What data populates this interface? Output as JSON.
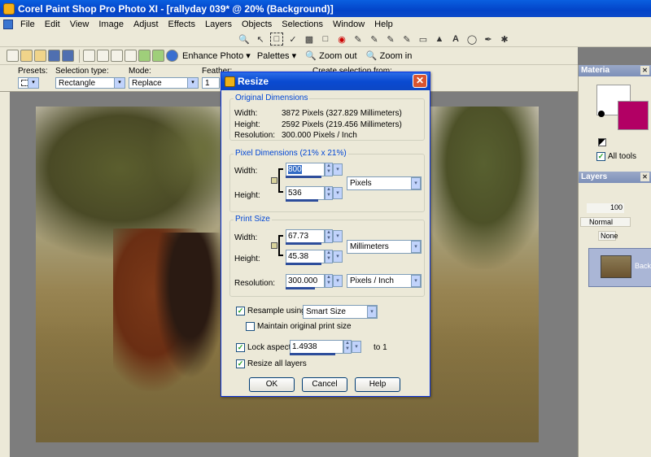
{
  "app": {
    "title": "Corel Paint Shop Pro Photo XI - [rallyday 039* @  20% (Background)]"
  },
  "menu": [
    "File",
    "Edit",
    "View",
    "Image",
    "Adjust",
    "Effects",
    "Layers",
    "Objects",
    "Selections",
    "Window",
    "Help"
  ],
  "toolbar": {
    "enhance_photo": "Enhance Photo",
    "palettes": "Palettes",
    "zoom_out": "Zoom out",
    "zoom_in": "Zoom in"
  },
  "options": {
    "presets_label": "Presets:",
    "selection_type_label": "Selection type:",
    "selection_type_value": "Rectangle",
    "mode_label": "Mode:",
    "mode_value": "Replace",
    "feather_label": "Feather:",
    "feather_value": "1",
    "create_from_label": "Create selection from:"
  },
  "materials": {
    "title": "Materia",
    "all_tools_label": "All tools",
    "foreground": "#ffffff",
    "background": "#b20064"
  },
  "layers": {
    "title": "Layers",
    "opacity": "100",
    "blend_mode": "Normal",
    "link": "None",
    "layer_name": "Backg"
  },
  "dialog": {
    "title": "Resize",
    "original": {
      "legend": "Original Dimensions",
      "width_label": "Width:",
      "width_value": "3872 Pixels (327.829 Millimeters)",
      "height_label": "Height:",
      "height_value": "2592 Pixels (219.456 Millimeters)",
      "resolution_label": "Resolution:",
      "resolution_value": "300.000 Pixels / Inch"
    },
    "pixel_dims": {
      "legend": "Pixel Dimensions (21% x 21%)",
      "width_label": "Width:",
      "width_value": "800",
      "height_label": "Height:",
      "height_value": "536",
      "units": "Pixels"
    },
    "print_size": {
      "legend": "Print Size",
      "width_label": "Width:",
      "width_value": "67.73",
      "height_label": "Height:",
      "height_value": "45.38",
      "units": "Millimeters",
      "resolution_label": "Resolution:",
      "resolution_value": "300.000",
      "resolution_units": "Pixels / Inch"
    },
    "resample_label": "Resample using:",
    "resample_value": "Smart Size",
    "maintain_label": "Maintain original print size",
    "lock_label": "Lock aspect ratio:",
    "lock_value": "1.4938",
    "to_one": "to 1",
    "resize_all_label": "Resize all layers",
    "ok": "OK",
    "cancel": "Cancel",
    "help": "Help"
  }
}
